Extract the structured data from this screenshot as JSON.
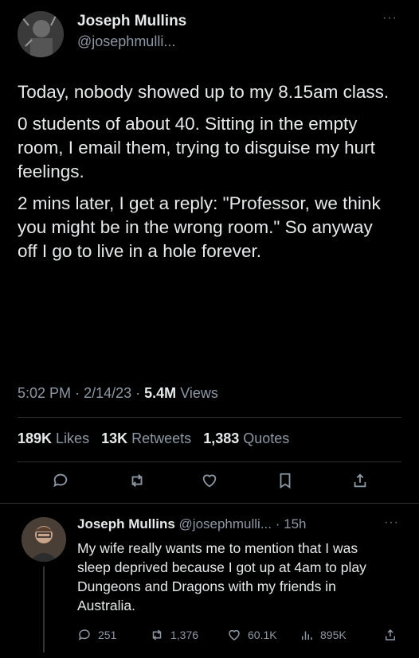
{
  "tweet": {
    "author_name": "Joseph Mullins",
    "author_handle": "@josephmulli...",
    "more": "···",
    "paragraphs": [
      "Today, nobody showed up to my 8.15am class.",
      "0 students of about 40.  Sitting in the empty room, I email them, trying to disguise my hurt feelings.",
      "2 mins later, I get a reply: \"Professor, we think you might be in the wrong room.\" So anyway off I go to live in a hole forever."
    ],
    "time": "5:02 PM",
    "date": "2/14/23",
    "views_count": "5.4M",
    "views_label": "Views",
    "likes_count": "189K",
    "likes_label": "Likes",
    "retweets_count": "13K",
    "retweets_label": "Retweets",
    "quotes_count": "1,383",
    "quotes_label": "Quotes",
    "icons": [
      "reply-icon",
      "retweet-icon",
      "like-icon",
      "bookmark-icon",
      "share-icon"
    ]
  },
  "reply": {
    "author_name": "Joseph Mullins",
    "author_handle": "@josephmulli...",
    "age": "15h",
    "more": "···",
    "text": "My wife really wants me to mention that I was sleep deprived because I got up at 4am to play Dungeons and Dragons with my friends in Australia.",
    "replies": "251",
    "retweets": "1,376",
    "likes": "60.1K",
    "views": "895K"
  },
  "colors": {
    "background": "#000000",
    "text": "#e7e9ea",
    "muted": "#8b98a5",
    "divider": "#2f3336"
  }
}
